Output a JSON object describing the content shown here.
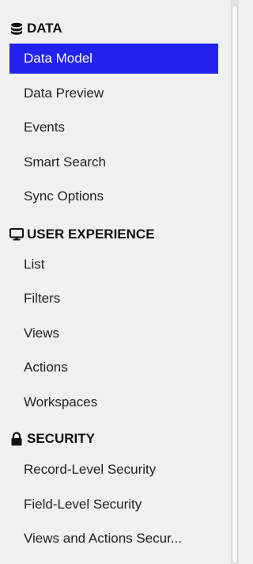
{
  "sections": [
    {
      "title": "DATA",
      "icon": "database-icon",
      "items": [
        "Data Model",
        "Data Preview",
        "Events",
        "Smart Search",
        "Sync Options"
      ]
    },
    {
      "title": "USER EXPERIENCE",
      "icon": "monitor-icon",
      "items": [
        "List",
        "Filters",
        "Views",
        "Actions",
        "Workspaces"
      ]
    },
    {
      "title": "SECURITY",
      "icon": "lock-icon",
      "items": [
        "Record-Level Security",
        "Field-Level Security",
        "Views and Actions Secur..."
      ]
    }
  ],
  "active_item": "Data Model",
  "colors": {
    "accent": "#2222ee",
    "background": "#f0f0f0"
  }
}
